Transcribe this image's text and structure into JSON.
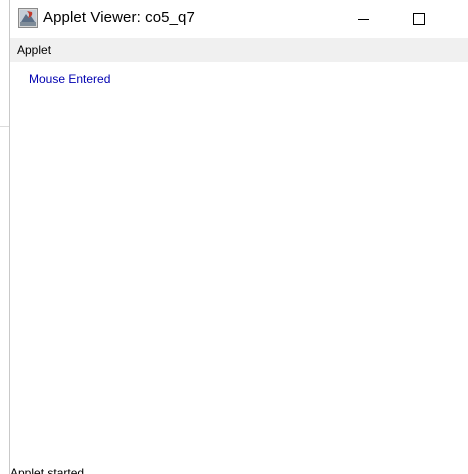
{
  "window": {
    "title": "Applet Viewer: co5_q7",
    "icon": "java-applet-icon"
  },
  "menubar": {
    "items": [
      {
        "label": "Applet"
      }
    ]
  },
  "canvas": {
    "message": "Mouse Entered",
    "message_color": "#0000b0"
  },
  "statusbar": {
    "text": "Applet started."
  }
}
